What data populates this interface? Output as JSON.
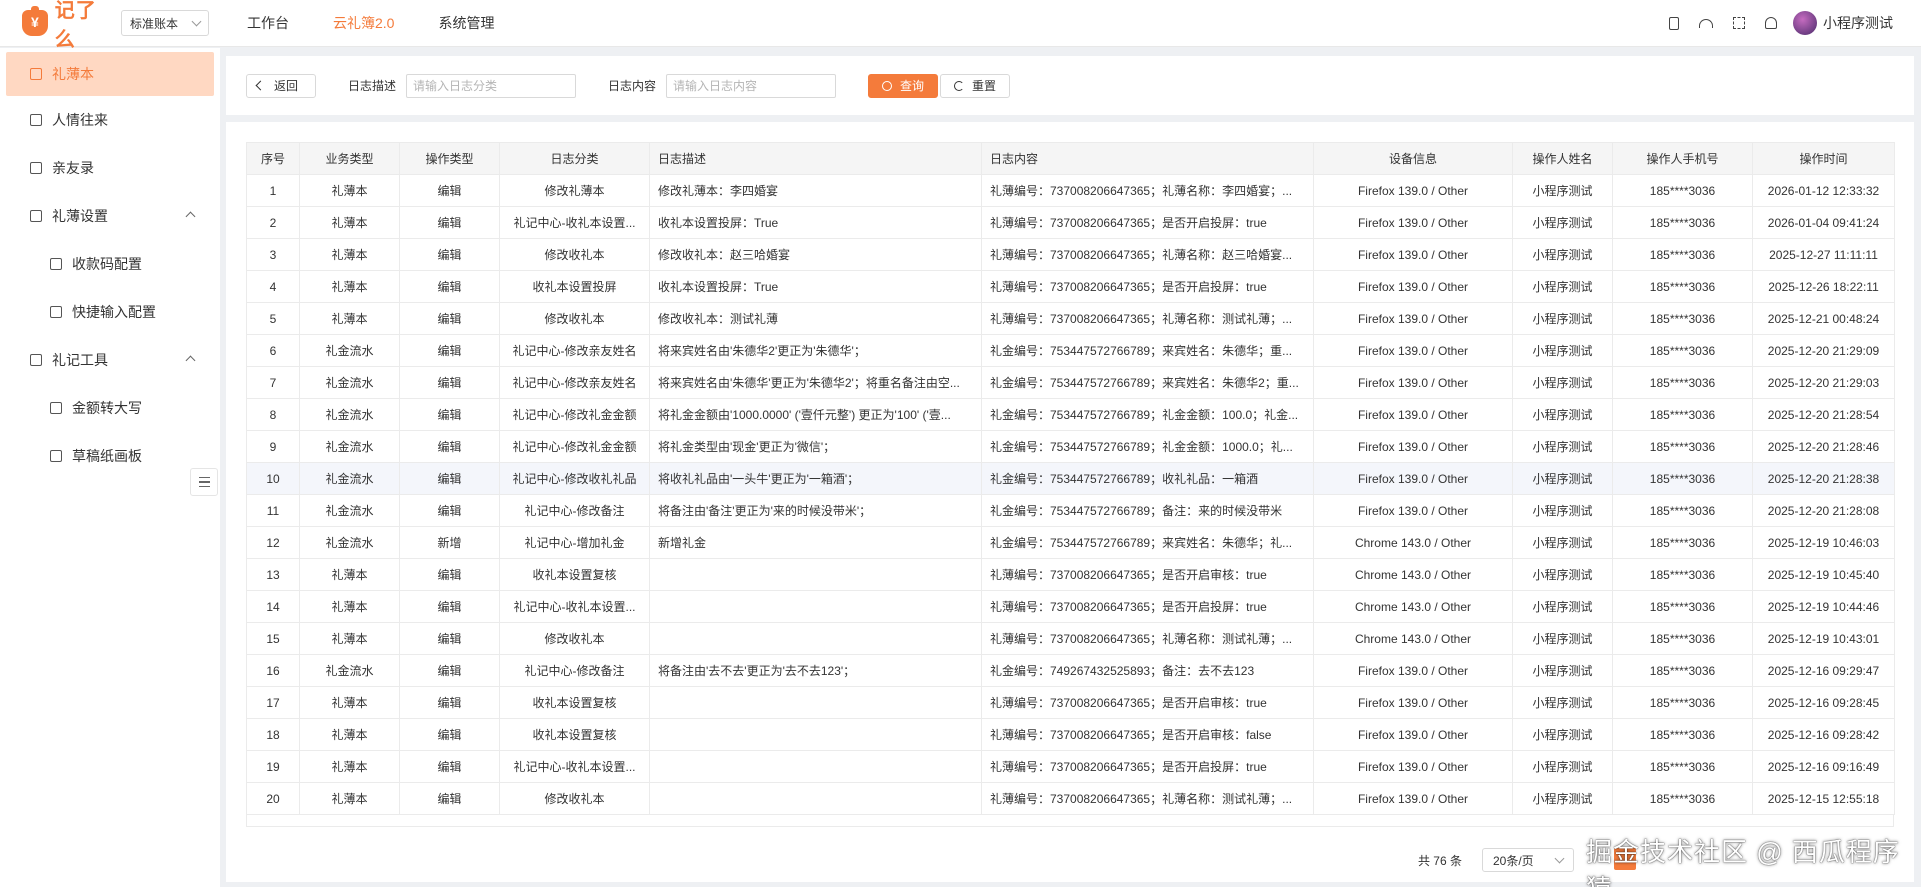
{
  "header": {
    "logo_text": "记了么",
    "account_select": "标准账本",
    "nav": [
      {
        "label": "工作台",
        "active": false
      },
      {
        "label": "云礼簿2.0",
        "active": true
      },
      {
        "label": "系统管理",
        "active": false
      }
    ],
    "icons": [
      "mobile-icon",
      "headset-icon",
      "fullscreen-icon",
      "bell-icon"
    ],
    "user_name": "小程序测试"
  },
  "sidebar": {
    "items": [
      {
        "label": "礼薄本",
        "icon": "book-icon",
        "active": true
      },
      {
        "label": "人情往来",
        "icon": "ledger-icon"
      },
      {
        "label": "亲友录",
        "icon": "folder-icon"
      },
      {
        "label": "礼薄设置",
        "icon": "gear-icon",
        "expanded": true
      },
      {
        "label": "收款码配置",
        "icon": "qrcode-icon",
        "sub": true
      },
      {
        "label": "快捷输入配置",
        "icon": "edit-icon",
        "sub": true
      },
      {
        "label": "礼记工具",
        "icon": "toolbox-icon",
        "expanded": true
      },
      {
        "label": "金额转大写",
        "icon": "calculator-icon",
        "sub": true
      },
      {
        "label": "草稿纸画板",
        "icon": "document-icon",
        "sub": true
      }
    ]
  },
  "filter": {
    "back_label": "返回",
    "desc_label": "日志描述",
    "desc_placeholder": "请输入日志分类",
    "content_label": "日志内容",
    "content_placeholder": "请输入日志内容",
    "query_label": "查询",
    "reset_label": "重置"
  },
  "table": {
    "columns": [
      "序号",
      "业务类型",
      "操作类型",
      "日志分类",
      "日志描述",
      "日志内容",
      "设备信息",
      "操作人姓名",
      "操作人手机号",
      "操作时间"
    ],
    "rows": [
      [
        "1",
        "礼薄本",
        "编辑",
        "修改礼薄本",
        "修改礼薄本：李四婚宴",
        "礼薄编号：737008206647365；礼薄名称：李四婚宴；...",
        "Firefox 139.0 / Other",
        "小程序测试",
        "185****3036",
        "2026-01-12 12:33:32"
      ],
      [
        "2",
        "礼薄本",
        "编辑",
        "礼记中心-收礼本设置...",
        "收礼本设置投屏：True",
        "礼薄编号：737008206647365；是否开启投屏：true",
        "Firefox 139.0 / Other",
        "小程序测试",
        "185****3036",
        "2026-01-04 09:41:24"
      ],
      [
        "3",
        "礼薄本",
        "编辑",
        "修改收礼本",
        "修改收礼本：赵三哈婚宴",
        "礼薄编号：737008206647365；礼薄名称：赵三哈婚宴...",
        "Firefox 139.0 / Other",
        "小程序测试",
        "185****3036",
        "2025-12-27 11:11:11"
      ],
      [
        "4",
        "礼薄本",
        "编辑",
        "收礼本设置投屏",
        "收礼本设置投屏：True",
        "礼薄编号：737008206647365；是否开启投屏：true",
        "Firefox 139.0 / Other",
        "小程序测试",
        "185****3036",
        "2025-12-26 18:22:11"
      ],
      [
        "5",
        "礼薄本",
        "编辑",
        "修改收礼本",
        "修改收礼本：测试礼薄",
        "礼薄编号：737008206647365；礼薄名称：测试礼薄；...",
        "Firefox 139.0 / Other",
        "小程序测试",
        "185****3036",
        "2025-12-21 00:48:24"
      ],
      [
        "6",
        "礼金流水",
        "编辑",
        "礼记中心-修改亲友姓名",
        "将来宾姓名由'朱德华2'更正为'朱德华'；",
        "礼金编号：753447572766789；来宾姓名：朱德华；重...",
        "Firefox 139.0 / Other",
        "小程序测试",
        "185****3036",
        "2025-12-20 21:29:09"
      ],
      [
        "7",
        "礼金流水",
        "编辑",
        "礼记中心-修改亲友姓名",
        "将来宾姓名由'朱德华'更正为'朱德华2'；将重名备注由空...",
        "礼金编号：753447572766789；来宾姓名：朱德华2；重...",
        "Firefox 139.0 / Other",
        "小程序测试",
        "185****3036",
        "2025-12-20 21:29:03"
      ],
      [
        "8",
        "礼金流水",
        "编辑",
        "礼记中心-修改礼金金额",
        "将礼金金额由'1000.0000' ('壹仟元整') 更正为'100' ('壹...",
        "礼金编号：753447572766789；礼金金额：100.0；礼金...",
        "Firefox 139.0 / Other",
        "小程序测试",
        "185****3036",
        "2025-12-20 21:28:54"
      ],
      [
        "9",
        "礼金流水",
        "编辑",
        "礼记中心-修改礼金金额",
        "将礼金类型由'现金'更正为'微信'；",
        "礼金编号：753447572766789；礼金金额：1000.0；礼...",
        "Firefox 139.0 / Other",
        "小程序测试",
        "185****3036",
        "2025-12-20 21:28:46"
      ],
      [
        "10",
        "礼金流水",
        "编辑",
        "礼记中心-修改收礼礼品",
        "将收礼礼品由'一头牛'更正为'一箱酒'；",
        "礼金编号：753447572766789；收礼礼品：一箱酒",
        "Firefox 139.0 / Other",
        "小程序测试",
        "185****3036",
        "2025-12-20 21:28:38"
      ],
      [
        "11",
        "礼金流水",
        "编辑",
        "礼记中心-修改备注",
        "将备注由'备注'更正为'来的时候没带米'；",
        "礼金编号：753447572766789；备注：来的时候没带米",
        "Firefox 139.0 / Other",
        "小程序测试",
        "185****3036",
        "2025-12-20 21:28:08"
      ],
      [
        "12",
        "礼金流水",
        "新增",
        "礼记中心-增加礼金",
        "新增礼金",
        "礼金编号：753447572766789；来宾姓名：朱德华；礼...",
        "Chrome 143.0 / Other",
        "小程序测试",
        "185****3036",
        "2025-12-19 10:46:03"
      ],
      [
        "13",
        "礼薄本",
        "编辑",
        "收礼本设置复核",
        "",
        "礼薄编号：737008206647365；是否开启审核：true",
        "Chrome 143.0 / Other",
        "小程序测试",
        "185****3036",
        "2025-12-19 10:45:40"
      ],
      [
        "14",
        "礼薄本",
        "编辑",
        "礼记中心-收礼本设置...",
        "",
        "礼薄编号：737008206647365；是否开启投屏：true",
        "Chrome 143.0 / Other",
        "小程序测试",
        "185****3036",
        "2025-12-19 10:44:46"
      ],
      [
        "15",
        "礼薄本",
        "编辑",
        "修改收礼本",
        "",
        "礼薄编号：737008206647365；礼薄名称：测试礼薄；...",
        "Chrome 143.0 / Other",
        "小程序测试",
        "185****3036",
        "2025-12-19 10:43:01"
      ],
      [
        "16",
        "礼金流水",
        "编辑",
        "礼记中心-修改备注",
        "将备注由'去不去'更正为'去不去123'；",
        "礼金编号：749267432525893；备注：去不去123",
        "Firefox 139.0 / Other",
        "小程序测试",
        "185****3036",
        "2025-12-16 09:29:47"
      ],
      [
        "17",
        "礼薄本",
        "编辑",
        "收礼本设置复核",
        "",
        "礼薄编号：737008206647365；是否开启审核：true",
        "Firefox 139.0 / Other",
        "小程序测试",
        "185****3036",
        "2025-12-16 09:28:45"
      ],
      [
        "18",
        "礼薄本",
        "编辑",
        "收礼本设置复核",
        "",
        "礼薄编号：737008206647365；是否开启审核：false",
        "Firefox 139.0 / Other",
        "小程序测试",
        "185****3036",
        "2025-12-16 09:28:42"
      ],
      [
        "19",
        "礼薄本",
        "编辑",
        "礼记中心-收礼本设置...",
        "",
        "礼薄编号：737008206647365；是否开启投屏：true",
        "Firefox 139.0 / Other",
        "小程序测试",
        "185****3036",
        "2025-12-16 09:16:49"
      ],
      [
        "20",
        "礼薄本",
        "编辑",
        "修改收礼本",
        "",
        "礼薄编号：737008206647365；礼薄名称：测试礼薄；...",
        "Firefox 139.0 / Other",
        "小程序测试",
        "185****3036",
        "2025-12-15 12:55:18"
      ]
    ],
    "highlighted_row": 10
  },
  "pager": {
    "total": "共 76 条",
    "page_size": "20条/页"
  },
  "watermark": "掘金技术社区 @ 西瓜程序猿",
  "colors": {
    "accent": "#f47b3b",
    "sidebar_active_bg": "#ffd8c2",
    "page_bg": "#eef0f3"
  }
}
